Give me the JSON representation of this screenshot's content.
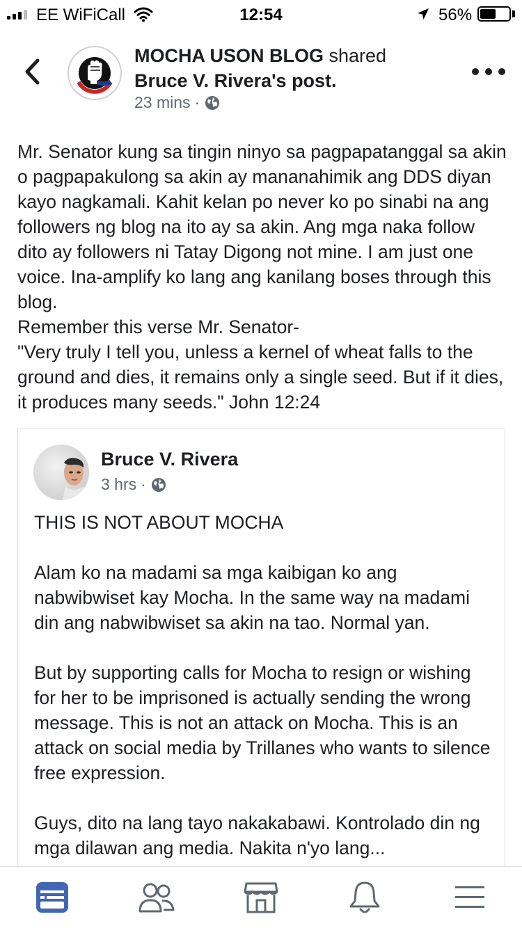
{
  "status_bar": {
    "carrier": "EE WiFiCall",
    "time": "12:54",
    "battery_percent": "56%",
    "battery_level": 0.56,
    "icons": [
      "signal-icon",
      "wifi-icon",
      "location-arrow-icon",
      "battery-icon"
    ]
  },
  "post": {
    "page_name": "MOCHA USON BLOG",
    "shared_word": "shared",
    "original_author": "Bruce V. Rivera",
    "possessive": "'s post.",
    "time": "23 mins",
    "separator": "·",
    "body": "Mr. Senator kung sa tingin ninyo sa pagpapatanggal sa akin o pagpapakulong sa akin ay mananahimik ang DDS diyan kayo nagkamali. Kahit kelan po never ko po sinabi na ang followers ng blog na ito ay sa akin. Ang mga naka follow dito ay followers ni Tatay Digong not mine. I am just one voice. Ina-amplify ko lang ang kanilang boses through this blog.\nRemember this verse Mr. Senator-\n\"Very truly I tell you, unless a kernel of wheat falls to the ground and dies, it remains only a single seed. But if it dies, it produces many seeds.\" John 12:24"
  },
  "shared_post": {
    "author": "Bruce V. Rivera",
    "time": "3 hrs",
    "separator": "·",
    "paragraphs": [
      "THIS IS NOT ABOUT MOCHA",
      "Alam ko na madami sa mga kaibigan ko ang nabwibwiset kay Mocha. In the same way na madami din ang nabwibwiset sa akin na tao. Normal yan.",
      "But by supporting calls for Mocha to resign or wishing for her to be imprisoned is actually sending the wrong message. This is not an attack on Mocha. This is an attack on social media by Trillanes who wants to silence free expression.",
      "Guys, dito na lang tayo nakakabawi. Kontrolado din ng mga dilawan ang media. Nakita n'yo lang..."
    ]
  },
  "bottom_nav": {
    "items": [
      {
        "icon": "news-feed-icon",
        "active": true
      },
      {
        "icon": "friends-icon",
        "active": false
      },
      {
        "icon": "marketplace-icon",
        "active": false
      },
      {
        "icon": "notifications-bell-icon",
        "active": false
      },
      {
        "icon": "menu-icon",
        "active": false
      }
    ],
    "active_color": "#4267b2",
    "inactive_color": "#606770"
  },
  "colors": {
    "text": "#1c1e21",
    "meta": "#606770",
    "border": "#dadde1",
    "accent": "#4267b2"
  }
}
